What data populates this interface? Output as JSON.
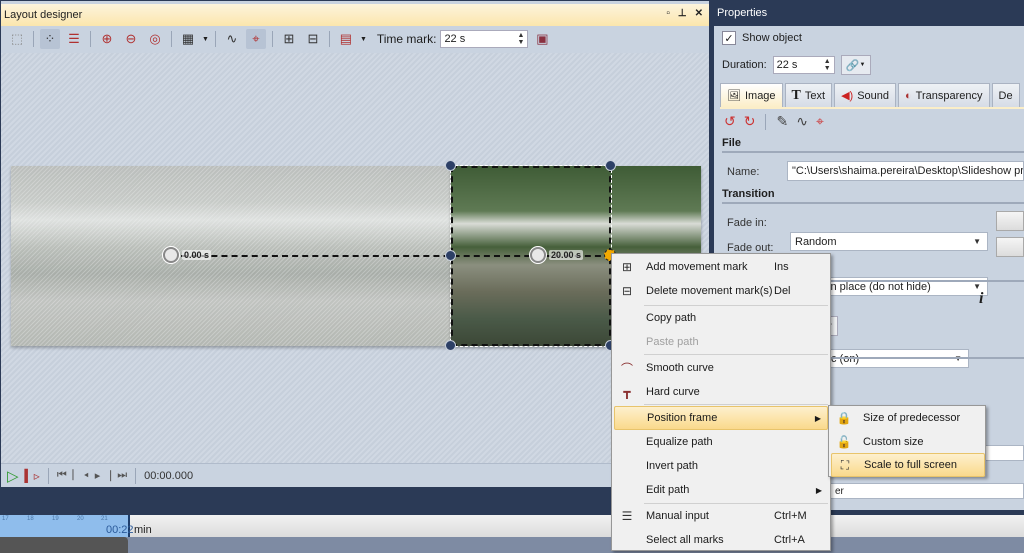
{
  "layout_designer": {
    "title": "Layout designer",
    "window_buttons": [
      "restore",
      "pin",
      "close"
    ],
    "toolbar": {
      "time_mark_label": "Time mark:",
      "time_mark_value": "22 s"
    },
    "canvas": {
      "marks": [
        {
          "label": "0.00 s"
        },
        {
          "label": "20.00 s"
        }
      ]
    },
    "playbar": {
      "time": "00:00.000"
    }
  },
  "timeline": {
    "ticks": [
      "17",
      "18",
      "19",
      "20",
      "21"
    ],
    "position_label": "00:22",
    "unit": "min"
  },
  "properties": {
    "title": "Properties",
    "show_object_label": "Show object",
    "show_object_checked": true,
    "duration_label": "Duration:",
    "duration_value": "22 s",
    "tabs": [
      {
        "label": "Image",
        "icon": "image-icon",
        "active": true
      },
      {
        "label": "Text",
        "icon": "text-icon",
        "active": false
      },
      {
        "label": "Sound",
        "icon": "sound-icon",
        "active": false
      },
      {
        "label": "Transparency",
        "icon": "transparency-icon",
        "active": false
      },
      {
        "label": "De",
        "icon": "",
        "active": false
      }
    ],
    "file_section": "File",
    "name_label": "Name:",
    "name_value": "\"C:\\Users\\shaima.pereira\\Desktop\\Slideshow project",
    "transition_section": "Transition",
    "fade_in_label": "Fade in:",
    "fade_in_value": "Random",
    "fade_out_label": "Fade out:",
    "fade_out_value": "Leave in place (do not hide)",
    "partial_dropdown_value": "c (on)",
    "partial_field_value": "er",
    "info_icon": "i"
  },
  "context_menu": {
    "items": [
      {
        "label": "Add movement mark",
        "shortcut": "Ins",
        "icon": "plus-box-icon"
      },
      {
        "label": "Delete movement mark(s)",
        "shortcut": "Del",
        "icon": "minus-box-icon"
      },
      {
        "label": "Copy path",
        "shortcut": ""
      },
      {
        "label": "Paste path",
        "shortcut": "",
        "disabled": true
      },
      {
        "label": "Smooth curve",
        "shortcut": "",
        "icon": "smooth-curve-icon"
      },
      {
        "label": "Hard curve",
        "shortcut": "",
        "icon": "hard-curve-icon"
      },
      {
        "label": "Position frame",
        "submenu": true,
        "highlighted": true
      },
      {
        "label": "Equalize path"
      },
      {
        "label": "Invert path"
      },
      {
        "label": "Edit path",
        "submenu": true
      },
      {
        "label": "Manual input",
        "shortcut": "Ctrl+M",
        "icon": "manual-input-icon"
      },
      {
        "label": "Select all marks",
        "shortcut": "Ctrl+A"
      }
    ]
  },
  "submenu": {
    "items": [
      {
        "label": "Size of predecessor",
        "icon": "lock-closed-icon"
      },
      {
        "label": "Custom size",
        "icon": "lock-open-icon"
      },
      {
        "label": "Scale to full screen",
        "icon": "fullscreen-icon",
        "highlighted": true
      }
    ]
  }
}
